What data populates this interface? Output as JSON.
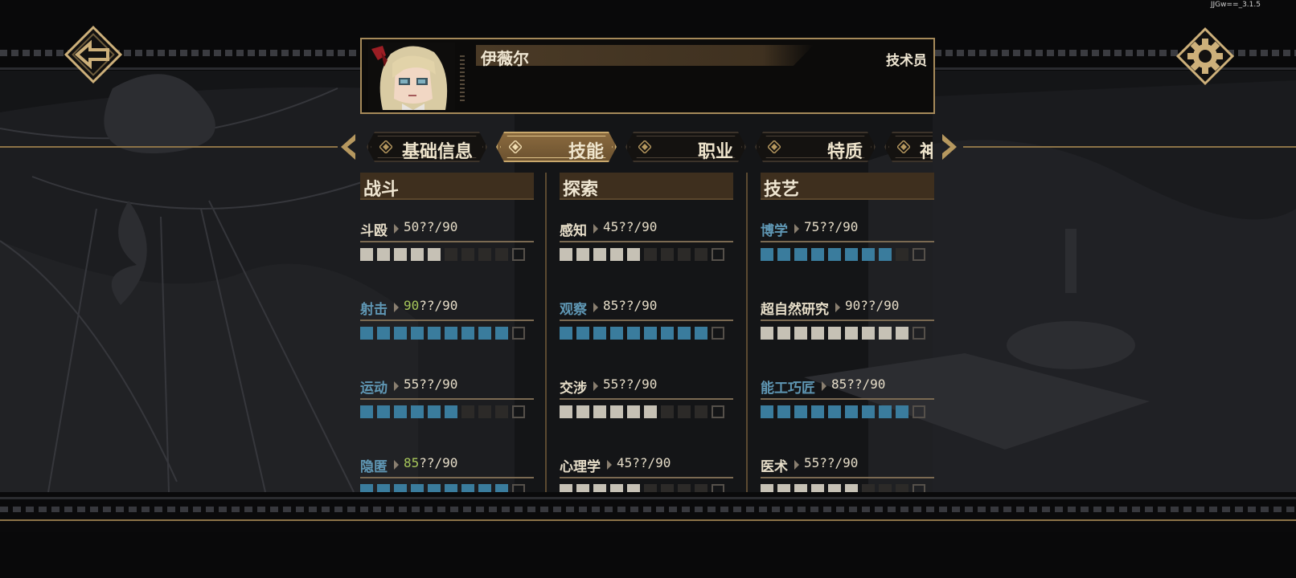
{
  "version": "JJGw==_3.1.5",
  "colors": {
    "gold": "#a68a5a",
    "accent_blue": "#3a7c9d",
    "pip_white": "#c6c1b5",
    "max_green": "#a7c75a"
  },
  "back_button": {
    "icon": "back-arrow-icon"
  },
  "settings_button": {
    "icon": "gear-icon"
  },
  "character": {
    "name": "伊薇尔",
    "role": "技术员"
  },
  "tabs": [
    {
      "label": "基础信息",
      "active": false
    },
    {
      "label": "技能",
      "active": true
    },
    {
      "label": "职业",
      "active": false
    },
    {
      "label": "特质",
      "active": false
    },
    {
      "label": "神",
      "active": false
    }
  ],
  "columns": [
    {
      "title": "战斗",
      "skills": [
        {
          "name": "斗殴",
          "value": 50,
          "value_text": "50",
          "max": "??/90",
          "style": "white",
          "highlight": false,
          "at_max": false
        },
        {
          "name": "射击",
          "value": 90,
          "value_text": "90",
          "max": "??/90",
          "style": "blue",
          "highlight": true,
          "at_max": true
        },
        {
          "name": "运动",
          "value": 55,
          "value_text": "55",
          "max": "??/90",
          "style": "blue",
          "highlight": true,
          "at_max": false
        },
        {
          "name": "隐匿",
          "value": 85,
          "value_text": "85",
          "max": "??/90",
          "style": "blue",
          "highlight": true,
          "at_max": true
        }
      ]
    },
    {
      "title": "探索",
      "skills": [
        {
          "name": "感知",
          "value": 45,
          "value_text": "45",
          "max": "??/90",
          "style": "white",
          "highlight": false,
          "at_max": false
        },
        {
          "name": "观察",
          "value": 85,
          "value_text": "85",
          "max": "??/90",
          "style": "blue",
          "highlight": true,
          "at_max": false
        },
        {
          "name": "交涉",
          "value": 55,
          "value_text": "55",
          "max": "??/90",
          "style": "white",
          "highlight": false,
          "at_max": false
        },
        {
          "name": "心理学",
          "value": 45,
          "value_text": "45",
          "max": "??/90",
          "style": "white",
          "highlight": false,
          "at_max": false
        }
      ]
    },
    {
      "title": "技艺",
      "skills": [
        {
          "name": "博学",
          "value": 75,
          "value_text": "75",
          "max": "??/90",
          "style": "blue",
          "highlight": true,
          "at_max": false
        },
        {
          "name": "超自然研究",
          "value": 90,
          "value_text": "90",
          "max": "??/90",
          "style": "white",
          "highlight": false,
          "at_max": false
        },
        {
          "name": "能工巧匠",
          "value": 85,
          "value_text": "85",
          "max": "??/90",
          "style": "blue",
          "highlight": true,
          "at_max": false
        },
        {
          "name": "医术",
          "value": 55,
          "value_text": "55",
          "max": "??/90",
          "style": "white",
          "highlight": false,
          "at_max": false
        }
      ]
    }
  ]
}
